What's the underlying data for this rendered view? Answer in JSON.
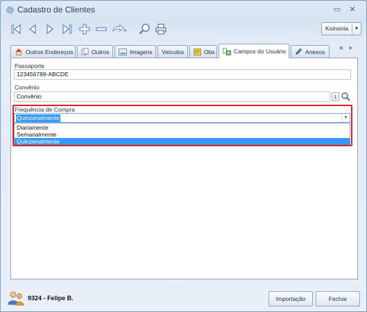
{
  "window": {
    "title": "Cadastro de Clientes",
    "minimize_icon": "minimize-icon",
    "close_icon": "close-icon"
  },
  "toolbar": {
    "icons": [
      "first-record-icon",
      "previous-record-icon",
      "next-record-icon",
      "last-record-icon",
      "add-icon",
      "remove-icon",
      "undo-icon",
      "search-icon",
      "print-icon"
    ],
    "company": "Koinonia"
  },
  "tabs": [
    {
      "label": "Outros Endereços",
      "icon": "house-icon",
      "active": false
    },
    {
      "label": "Outros",
      "icon": "documents-icon",
      "active": false
    },
    {
      "label": "Imagens",
      "icon": "image-icon",
      "active": false
    },
    {
      "label": "Veículos",
      "icon": "",
      "active": false
    },
    {
      "label": "Obs",
      "icon": "note-icon",
      "active": false
    },
    {
      "label": "Campos do Usuário",
      "icon": "user-fields-icon",
      "active": true
    },
    {
      "label": "Anexos",
      "icon": "paperclip-icon",
      "active": false
    }
  ],
  "form": {
    "passaporte_label": "Passaporte",
    "passaporte_value": "123456789-ABCDE",
    "convenio_label": "Convênio",
    "convenio_value": "Convênio",
    "convenio_lookup": "1",
    "frequencia_label": "Frequência de Compra",
    "frequencia_value": "Quinzenalmente",
    "frequencia_options": [
      "Diariamente",
      "Semanalmente",
      "Quinzenalmente"
    ]
  },
  "footer": {
    "user_id": "9324",
    "separator": "-",
    "user_name": "Felipe B.",
    "import_button": "Importação",
    "close_button": "Fechar"
  },
  "colors": {
    "accent": "#3399ff",
    "highlight_border": "#e0201e",
    "panel_border": "#8fa7c6"
  }
}
